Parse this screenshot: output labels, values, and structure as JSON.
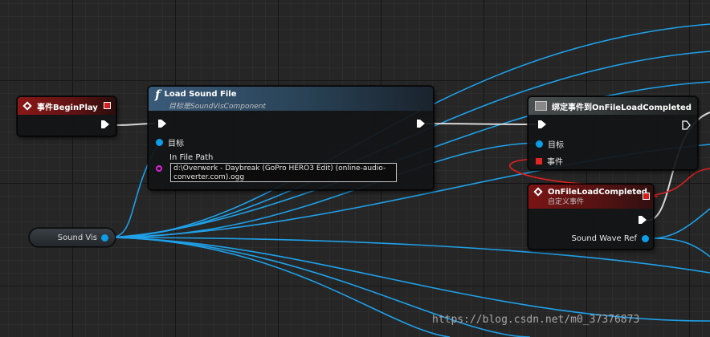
{
  "colors": {
    "background": "#262626",
    "exec_wire": "#ffffff",
    "object_pin": "#0d9ee6",
    "string_pin": "#e01fe0",
    "delegate_pin": "#e22626"
  },
  "nodes": {
    "begin_play": {
      "title": "事件BeginPlay",
      "icon": "event-diamond-icon"
    },
    "load_sound_file": {
      "title": "Load Sound File",
      "subtitle": "目标是SoundVisComponent",
      "icon": "function-icon",
      "pin_target": "目标",
      "pin_in_file_path": "In File Path",
      "file_path_value": "d:\\Overwerk - Daybreak (GoPro HERO3 Edit) (online-audio-converter.com).ogg"
    },
    "bind_event": {
      "title": "绑定事件到OnFileLoadCompleted",
      "icon": "bind-event-icon",
      "pin_target": "目标",
      "pin_event": "事件"
    },
    "on_file_load_completed": {
      "title": "OnFileLoadCompleted",
      "subtitle": "自定义事件",
      "pin_sound_wave_ref": "Sound Wave Ref"
    },
    "sound_vis": {
      "label": "Sound Vis"
    }
  },
  "watermark": "https://blog.csdn.net/m0_37376873"
}
